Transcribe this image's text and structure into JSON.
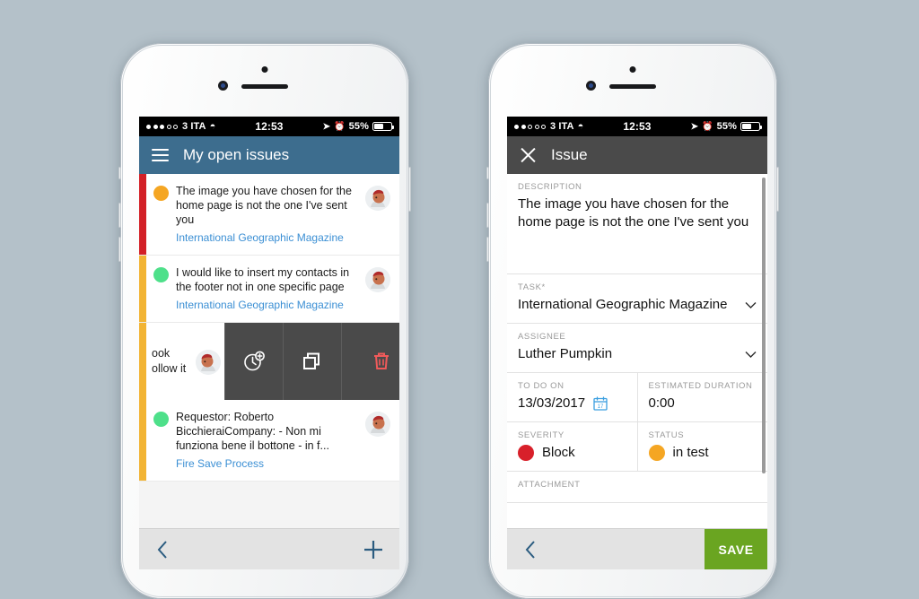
{
  "background_color": "#b4c1c9",
  "colors": {
    "header_blue": "#3d6d8e",
    "header_gray": "#4a4a4a",
    "link_blue": "#3b8fd4",
    "save_green": "#6aa521",
    "toolbar_icon": "#2b5c80",
    "stripe_red": "#d32027",
    "stripe_amber": "#f2b434",
    "dot_orange": "#f5a623",
    "dot_green": "#4ee08a",
    "severity_red": "#d8202a",
    "status_orange": "#f5a623",
    "calendar_blue": "#3b9fe0"
  },
  "left_phone": {
    "status_bar": {
      "signal_dots_filled": 3,
      "signal_dots_total": 5,
      "carrier": "3 ITA",
      "wifi_icon": "wifi-icon",
      "time": "12:53",
      "location_icon": "location-arrow-icon",
      "alarm_icon": "alarm-clock-icon",
      "battery_percent": "55%",
      "battery_icon": "battery-icon"
    },
    "header": {
      "menu_icon": "hamburger-menu-icon",
      "title": "My open issues"
    },
    "issues": [
      {
        "stripe": "#d32027",
        "dot": "#f5a623",
        "title": "The image you have chosen for the home page is not the one I've sent you",
        "subtitle": "International Geographic Magazine",
        "avatar": "user-avatar"
      },
      {
        "stripe": "#f2b434",
        "dot": "#4ee08a",
        "title": "I would like to insert my contacts in the footer not in one specific page",
        "subtitle": "International Geographic Magazine",
        "avatar": "user-avatar"
      }
    ],
    "swiped_row": {
      "stripe": "#f2b434",
      "text_line_1": "ook",
      "text_line_2": "ollow it",
      "avatar": "user-avatar",
      "actions": [
        {
          "icon": "add-time-icon",
          "name": "add-time-action"
        },
        {
          "icon": "copy-icon",
          "name": "duplicate-action"
        },
        {
          "icon": "trash-icon",
          "name": "delete-action"
        }
      ]
    },
    "issues_after": [
      {
        "stripe": "#f2b434",
        "dot": "#4ee08a",
        "title": "Requestor: Roberto BicchieraiCompany: - Non mi funziona bene il bottone - in f...",
        "subtitle": "Fire Save Process",
        "avatar": "user-avatar"
      }
    ],
    "toolbar": {
      "back_icon": "chevron-left-icon",
      "add_icon": "plus-icon"
    }
  },
  "right_phone": {
    "status_bar": {
      "signal_dots_filled": 2,
      "signal_dots_total": 5,
      "carrier": "3 ITA",
      "wifi_icon": "wifi-icon",
      "time": "12:53",
      "location_icon": "location-arrow-icon",
      "alarm_icon": "alarm-clock-icon",
      "battery_percent": "55%",
      "battery_icon": "battery-icon"
    },
    "header": {
      "close_icon": "close-x-icon",
      "title": "Issue"
    },
    "fields": {
      "description_label": "DESCRIPTION",
      "description_value": "The image you have chosen for the home page is not the one I've sent you",
      "task_label": "TASK*",
      "task_value": "International Geographic Magazine",
      "task_chevron": "chevron-down-icon",
      "assignee_label": "ASSIGNEE",
      "assignee_value": "Luther Pumpkin",
      "assignee_chevron": "chevron-down-icon",
      "todo_label": "TO DO ON",
      "todo_value": "13/03/2017",
      "todo_icon": "calendar-icon",
      "todo_icon_day": "17",
      "duration_label": "ESTIMATED DURATION",
      "duration_value": "0:00",
      "severity_label": "SEVERITY",
      "severity_value": "Block",
      "severity_color": "#d8202a",
      "status_label": "STATUS",
      "status_value": "in test",
      "status_color": "#f5a623",
      "attachment_label": "ATTACHMENT"
    },
    "toolbar": {
      "back_icon": "chevron-left-icon",
      "save_label": "SAVE"
    }
  }
}
